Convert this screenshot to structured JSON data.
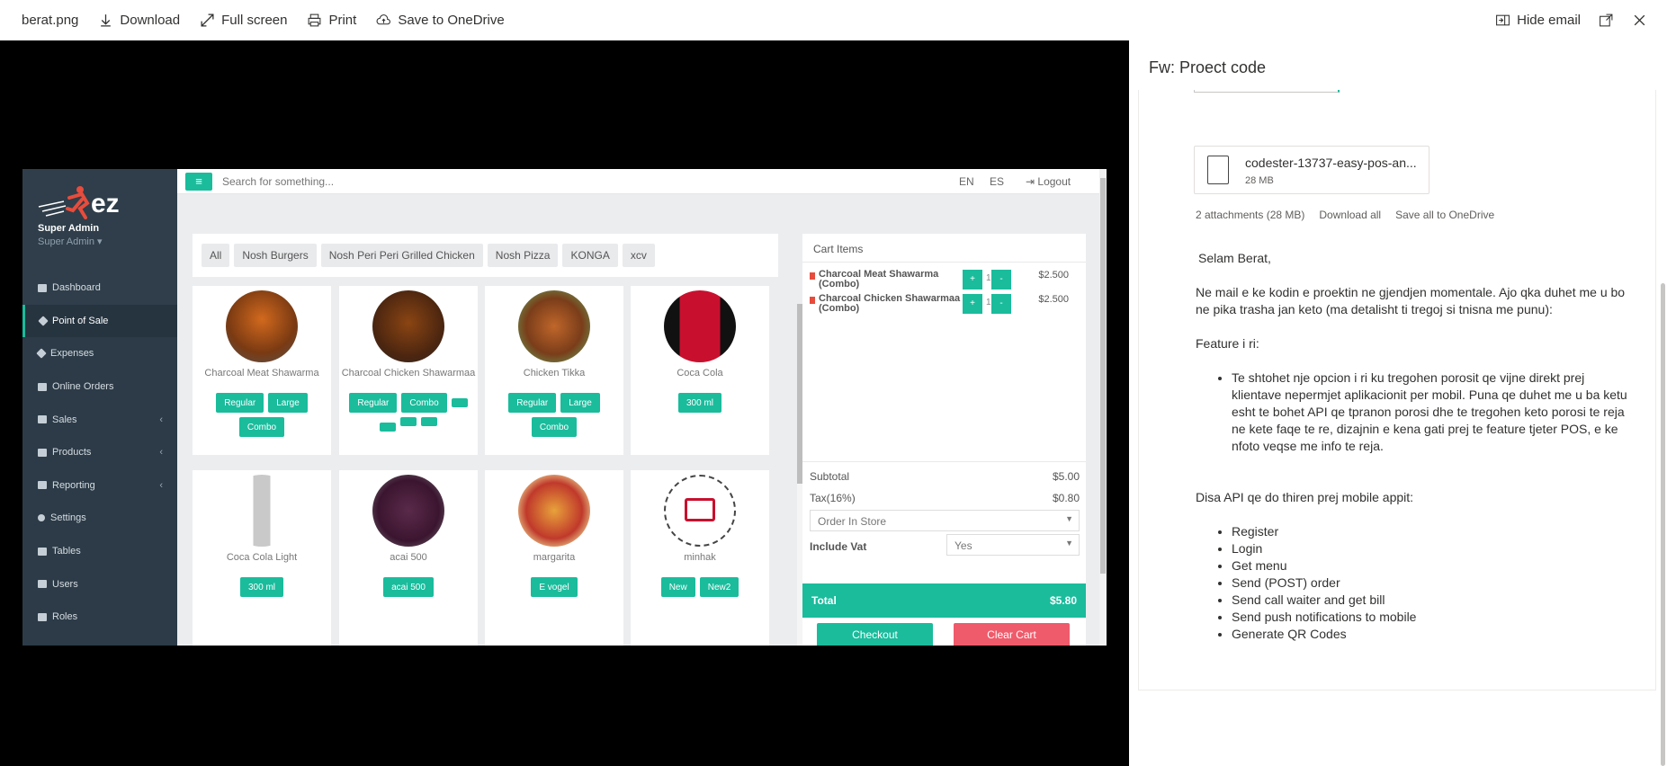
{
  "toolbar": {
    "filename": "berat.png",
    "download": "Download",
    "fullscreen": "Full screen",
    "print": "Print",
    "save_onedrive": "Save to OneDrive",
    "hide_email": "Hide email"
  },
  "pos": {
    "user": {
      "name": "Super Admin",
      "role": "Super Admin"
    },
    "sidebar": [
      {
        "label": "Dashboard",
        "active": false
      },
      {
        "label": "Point of Sale",
        "active": true
      },
      {
        "label": "Expenses",
        "active": false
      },
      {
        "label": "Online Orders",
        "active": false
      },
      {
        "label": "Sales",
        "active": false
      },
      {
        "label": "Products",
        "active": false
      },
      {
        "label": "Reporting",
        "active": false
      },
      {
        "label": "Settings",
        "active": false
      },
      {
        "label": "Tables",
        "active": false
      },
      {
        "label": "Users",
        "active": false
      },
      {
        "label": "Roles",
        "active": false
      }
    ],
    "search_placeholder": "Search for something...",
    "lang_en": "EN",
    "lang_es": "ES",
    "logout": "Logout",
    "categories": [
      "All",
      "Nosh Burgers",
      "Nosh Peri Peri Grilled Chicken",
      "Nosh Pizza",
      "KONGA",
      "xcv"
    ],
    "products": [
      {
        "name": "Charcoal Meat Shawarma",
        "options": [
          "Regular",
          "Large",
          "Combo"
        ]
      },
      {
        "name": "Charcoal Chicken Shawarmaa",
        "options": [
          "Regular",
          "Combo"
        ]
      },
      {
        "name": "Chicken Tikka",
        "options": [
          "Regular",
          "Large",
          "Combo"
        ]
      },
      {
        "name": "Coca Cola",
        "options": [
          "300 ml"
        ]
      },
      {
        "name": "Coca Cola Light",
        "options": [
          "300 ml"
        ]
      },
      {
        "name": "acai 500",
        "options": [
          "acai 500"
        ]
      },
      {
        "name": "margarita",
        "options": [
          "E vogel"
        ]
      },
      {
        "name": "minhak",
        "options": [
          "New",
          "New2"
        ]
      }
    ],
    "cart": {
      "title": "Cart Items",
      "items": [
        {
          "name": "Charcoal Meat Shawarma (Combo)",
          "qty": "1",
          "price": "$2.500"
        },
        {
          "name": "Charcoal Chicken Shawarmaa (Combo)",
          "qty": "1",
          "price": "$2.500"
        }
      ],
      "subtotal_label": "Subtotal",
      "subtotal": "$5.00",
      "tax_label": "Tax(16%)",
      "tax": "$0.80",
      "order_type": "Order In Store",
      "vat_label": "Include Vat",
      "vat_value": "Yes",
      "total_label": "Total",
      "total": "$5.80",
      "checkout": "Checkout",
      "clear": "Clear Cart"
    }
  },
  "email": {
    "subject": "Fw: Proect code",
    "attachment_name": "codester-13737-easy-pos-an...",
    "attachment_size": "28 MB",
    "attachments_count": "2 attachments (28 MB)",
    "download_all": "Download all",
    "save_all": "Save all to OneDrive",
    "greeting": "Selam Berat,",
    "para1": "Ne mail e ke kodin e proektin ne gjendjen momentale. Ajo qka duhet me u bo ne pika trasha jan keto (ma detalisht ti tregoj si tnisna me punu):",
    "feature_heading": "Feature i ri:",
    "feature_item": "Te shtohet nje opcion i ri ku tregohen porosit qe vijne direkt prej klientave nepermjet aplikacionit per mobil. Puna qe duhet me u ba ketu esht te bohet API qe tpranon porosi dhe te tregohen keto porosi te reja ne kete faqe te re, dizajnin e kena gati prej te feature tjeter POS, e ke nfoto veqse me info te reja.",
    "api_heading": "Disa API qe do thiren prej mobile appit:",
    "api_items": [
      "Register",
      "Login",
      "Get menu",
      "Send (POST) order",
      "Send call waiter and get bill",
      "Send push notifications to mobile",
      "Generate QR Codes"
    ]
  }
}
